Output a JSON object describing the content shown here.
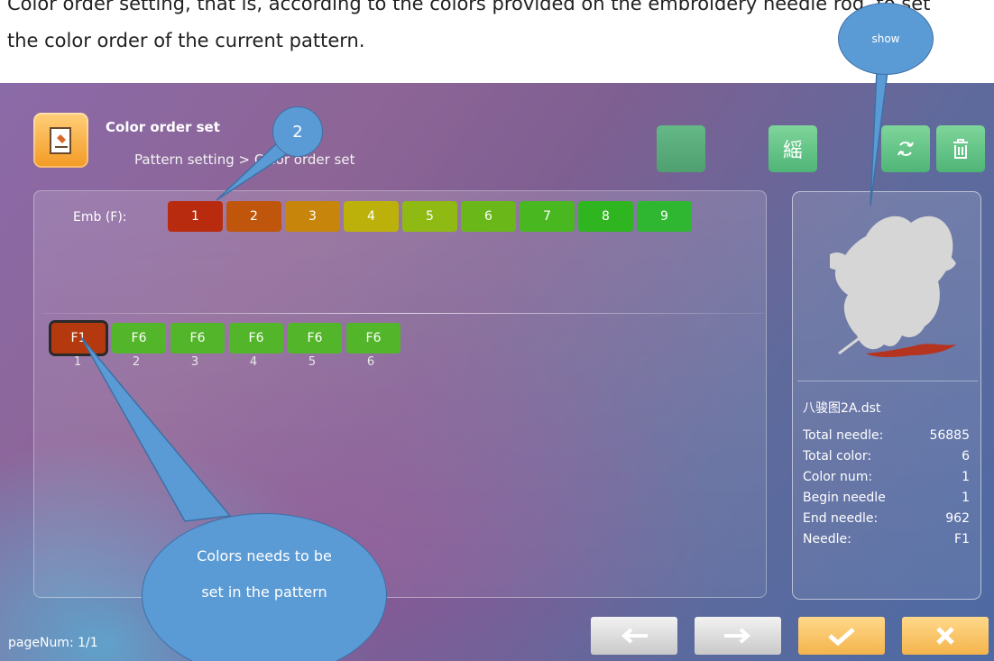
{
  "document": {
    "line1": "Color order setting, that is, according to the colors provided on the embroidery needle rod, to set",
    "line2": "the color order of the current pattern."
  },
  "header": {
    "title": "Color order set",
    "breadcrumb": "Pattern setting > Color order set",
    "icon": "pattern-file-icon"
  },
  "toolbar": {
    "emb_glyph": "䌊",
    "buttons": [
      "blank-tool",
      "embroidery-tool",
      "refresh-icon",
      "trash-icon"
    ]
  },
  "emb_row": {
    "label": "Emb (F):",
    "needles": [
      {
        "label": "1",
        "color": "#b92b0f"
      },
      {
        "label": "2",
        "color": "#c0560c"
      },
      {
        "label": "3",
        "color": "#c7860b"
      },
      {
        "label": "4",
        "color": "#bcb10a"
      },
      {
        "label": "5",
        "color": "#8fba14"
      },
      {
        "label": "6",
        "color": "#6ab719"
      },
      {
        "label": "7",
        "color": "#49b71f"
      },
      {
        "label": "8",
        "color": "#2fb51f"
      },
      {
        "label": "9",
        "color": "#2fb731"
      }
    ]
  },
  "sequence": [
    {
      "label": "F1",
      "num": "1"
    },
    {
      "label": "F6",
      "num": "2"
    },
    {
      "label": "F6",
      "num": "3"
    },
    {
      "label": "F6",
      "num": "4"
    },
    {
      "label": "F6",
      "num": "5"
    },
    {
      "label": "F6",
      "num": "6"
    }
  ],
  "info": {
    "file_name": "八骏图2A.dst",
    "rows": [
      {
        "key": "Total needle:",
        "value": "56885"
      },
      {
        "key": "Total color:",
        "value": "6"
      },
      {
        "key": "Color num:",
        "value": "1"
      },
      {
        "key": "Begin needle",
        "value": "1"
      },
      {
        "key": "End needle:",
        "value": "962"
      },
      {
        "key": "Needle:",
        "value": "F1"
      }
    ]
  },
  "footer": {
    "page_num": "pageNum: 1/1",
    "prev": "←",
    "next": "→",
    "confirm": "✔",
    "cancel": "✕"
  },
  "callouts": {
    "show": "show",
    "two": "2",
    "colors_line1": "Colors needs to be",
    "colors_line2": "set in the pattern",
    "fill": "#5b9bd5"
  }
}
